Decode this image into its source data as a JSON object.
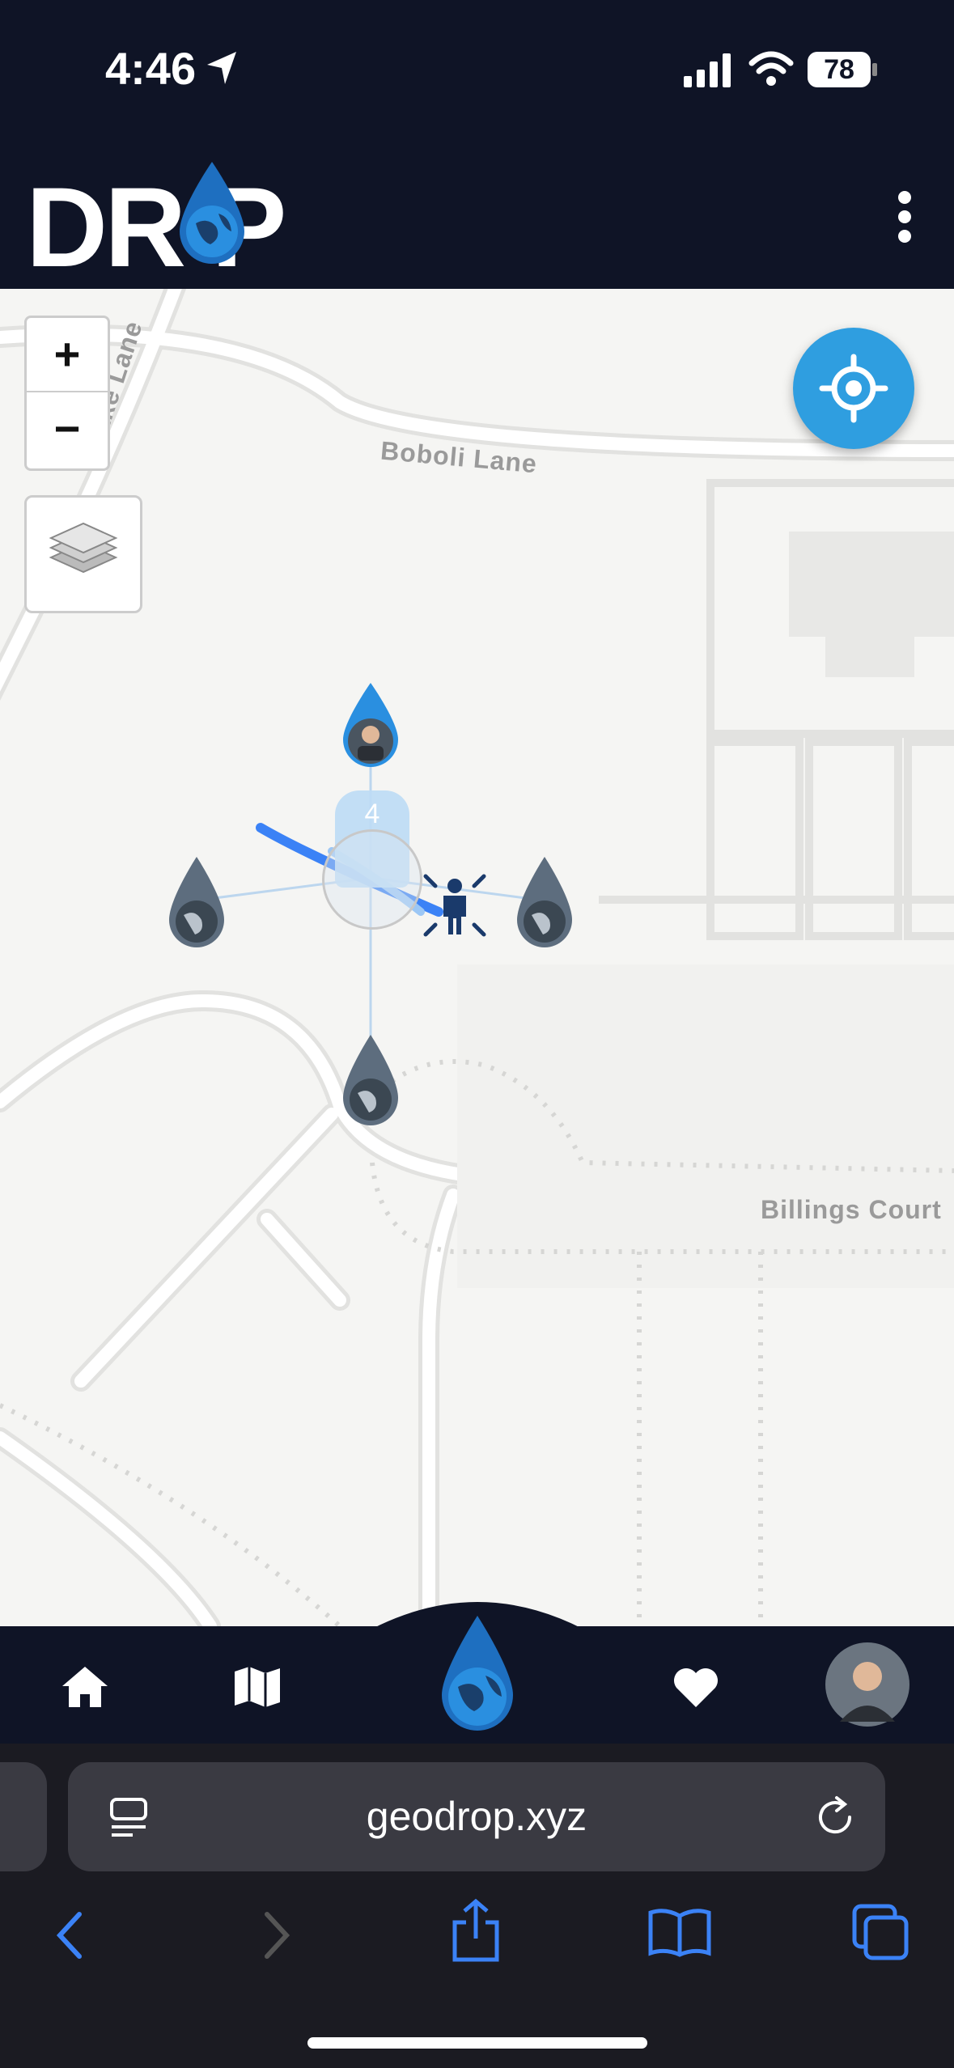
{
  "status_bar": {
    "time": "4:46",
    "battery": "78"
  },
  "header": {
    "logo_text": "DR P"
  },
  "map": {
    "streets": [
      "Boboli Lane",
      "Billings Court",
      "slake Lane"
    ],
    "cluster_count": "4"
  },
  "browser": {
    "url": "geodrop.xyz"
  },
  "colors": {
    "brand_dark": "#0f1426",
    "accent_blue": "#2f9ee0",
    "browser_blue": "#3b82f6"
  }
}
